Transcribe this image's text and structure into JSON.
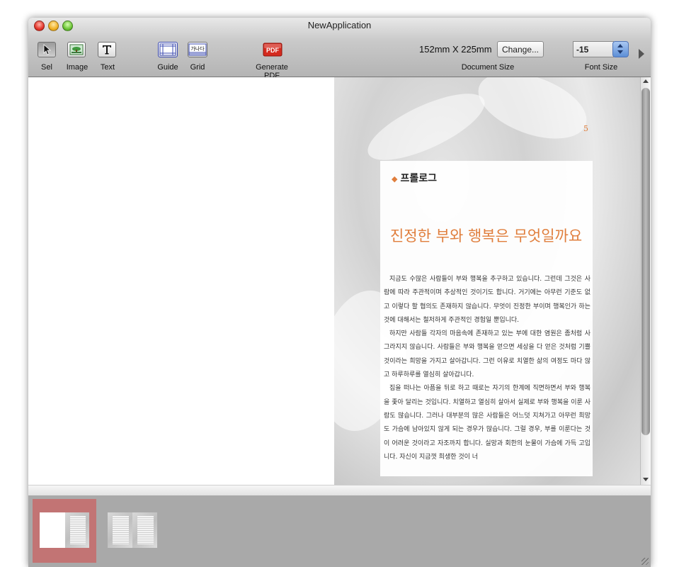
{
  "window": {
    "title": "NewApplication"
  },
  "toolbar": {
    "tools": [
      {
        "label": "Sel",
        "icon": "arrow-cursor-icon"
      },
      {
        "label": "Image",
        "icon": "landscape-image-icon"
      },
      {
        "label": "Text",
        "icon": "text-t-icon"
      },
      {
        "label": "Guide",
        "icon": "guide-grid-icon"
      },
      {
        "label": "Grid",
        "icon": "grid-icon"
      },
      {
        "label": "Generate PDF",
        "icon": "pdf-icon"
      }
    ],
    "grid_icon_text": "가나다",
    "pdf_icon_text": "PDF",
    "document_size": {
      "value": "152mm X 225mm",
      "button": "Change...",
      "label": "Document Size"
    },
    "font_size": {
      "value": "-15",
      "label": "Font Size"
    },
    "colors": {
      "pdf_red": "#d42a1e",
      "selection": "#c27474",
      "accent_orange": "#e07e3c"
    }
  },
  "page": {
    "page_number": "5",
    "section": "프롤로그",
    "headline": "진정한 부와 행복은 무엇일까요",
    "paragraphs": [
      "지금도 수많은 사람들이 부와 행복을 추구하고 있습니다. 그런데 그것은 사람에 따라 주관적이며 추상적인 것이기도 합니다. 거기에는 아무런 기준도 없고 이렇다 할 협의도 존재하지 않습니다. 무엇이 진정한 부이며 행복인가 하는 것에 대해서는 철저하게 주관적인 경험일 뿐입니다.",
      "하지만 사람들 각자의 마음속에 존재하고 있는 부에 대한 염원은 좀처럼 사그라지지 않습니다. 사람들은 부와 행복을 얻으면 세상을 다 얻은 것처럼 기쁠 것이라는 희망을 가지고 살아갑니다. 그런 이유로 치열한 삶의 여정도 마다 않고 하루하루를 열심히 살아갑니다.",
      "집을 떠나는 아픔을 뒤로 하고 때로는 자기의 한계에 직면하면서 부와 행복을 좇아 달리는 것입니다. 치열하고 열심히 살아서 실제로 부와 행복을 이룬 사람도 많습니다. 그러나 대부분의 많은 사람들은 어느덧 지쳐가고 아무런 희망도 가슴에 남아있지 않게 되는 경우가 많습니다. 그럴 경우, 부를 이룬다는 것이 어려운 것이라고 자조까지 합니다. 실망과 회한의 눈물이 가슴에 가득 고입니다. 자신이 지금껏 희생한 것이 너"
    ]
  }
}
